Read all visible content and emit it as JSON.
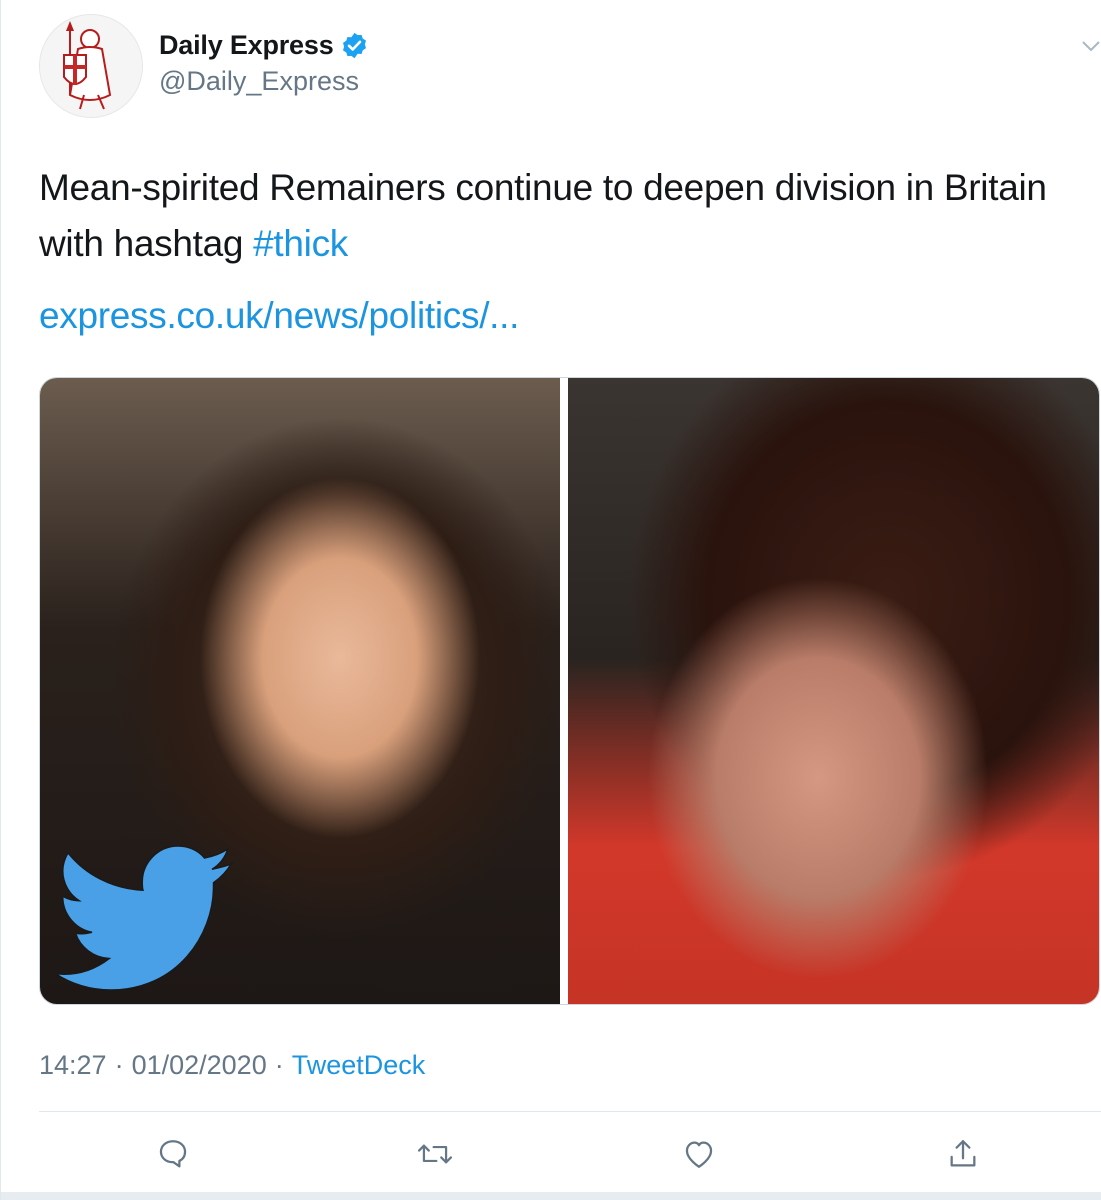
{
  "author": {
    "display_name": "Daily Express",
    "handle": "@Daily_Express",
    "verified": true
  },
  "tweet": {
    "text_main": "Mean-spirited Remainers continue to deepen division in Britain with hashtag ",
    "hashtag": "#thick",
    "link": "express.co.uk/news/politics/..."
  },
  "meta": {
    "time": "14:27",
    "separator": "·",
    "date": "01/02/2020",
    "source": "TweetDeck"
  },
  "actions": {
    "reply": "reply-icon",
    "retweet": "retweet-icon",
    "like": "heart-icon",
    "share": "share-icon"
  },
  "colors": {
    "link": "#1b95e0",
    "secondary_text": "#657786",
    "verified_badge": "#1da1f2",
    "twitter_bird": "#4aa0e6"
  }
}
